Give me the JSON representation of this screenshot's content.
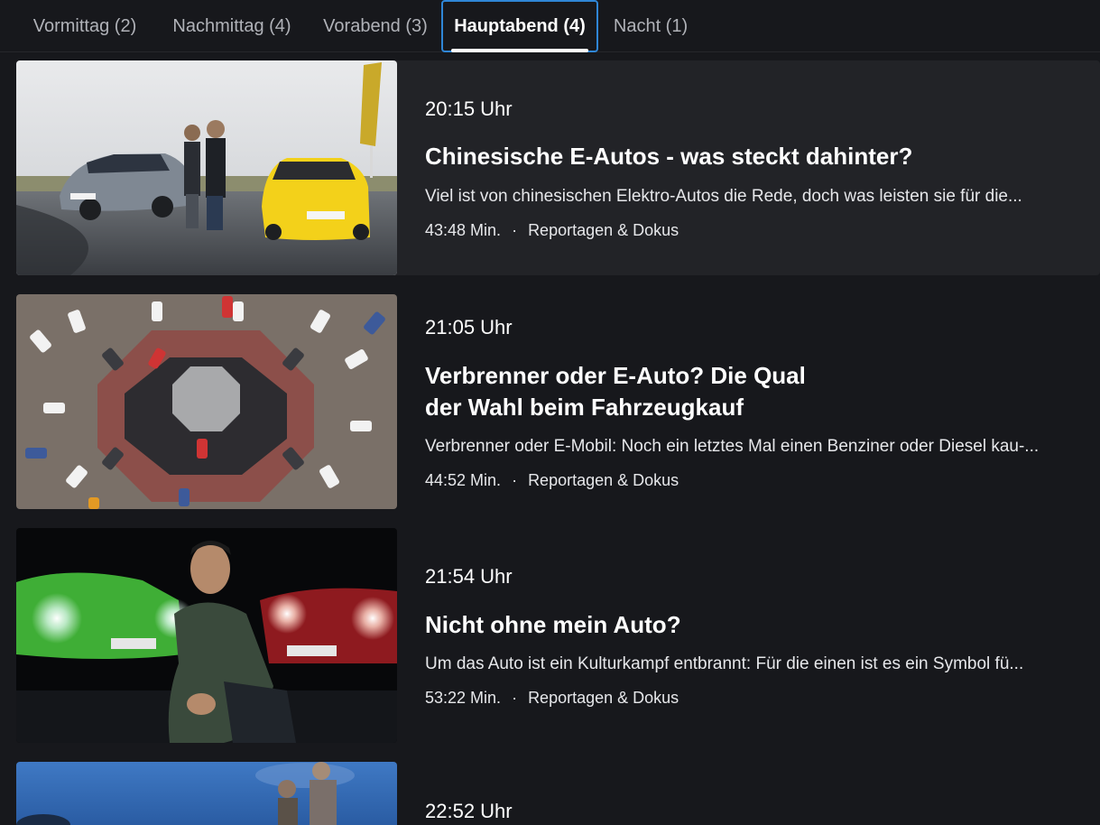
{
  "tabs": [
    {
      "label": "Vormittag (2)",
      "active": false
    },
    {
      "label": "Nachmittag (4)",
      "active": false
    },
    {
      "label": "Vorabend (3)",
      "active": false
    },
    {
      "label": "Hauptabend (4)",
      "active": true
    },
    {
      "label": "Nacht (1)",
      "active": false
    }
  ],
  "colors": {
    "background": "#17181c",
    "highlight_row": "#222327",
    "active_tab_border": "#2f86d6",
    "text_primary": "#ffffff",
    "text_secondary": "#b0b2b8"
  },
  "items": [
    {
      "time": "20:15 Uhr",
      "title": "Chinesische E-Autos - was steckt dahinter?",
      "description": "Viel ist von chinesischen Elektro-Autos die Rede, doch was leisten sie für die...",
      "duration": "43:48 Min.",
      "separator": "·",
      "category": "Reportagen & Dokus",
      "thumbnail": "two-men-with-e-cars-thumbnail"
    },
    {
      "time": "21:05 Uhr",
      "title": "Verbrenner oder E-Auto? Die Qual der Wahl beim Fahrzeugkauf",
      "description": "Verbrenner oder E-Mobil: Noch ein letztes Mal einen Benziner oder Diesel kau-...",
      "duration": "44:52 Min.",
      "separator": "·",
      "category": "Reportagen & Dokus",
      "thumbnail": "parking-lot-aerial-thumbnail"
    },
    {
      "time": "21:54 Uhr",
      "title": "Nicht ohne mein Auto?",
      "description": "Um das Auto ist ein Kulturkampf entbrannt: Für die einen ist es ein Symbol fü...",
      "duration": "53:22 Min.",
      "separator": "·",
      "category": "Reportagen & Dokus",
      "thumbnail": "man-in-front-of-cars-night-thumbnail"
    },
    {
      "time": "22:52 Uhr",
      "thumbnail": "blue-sky-people-thumbnail"
    }
  ]
}
